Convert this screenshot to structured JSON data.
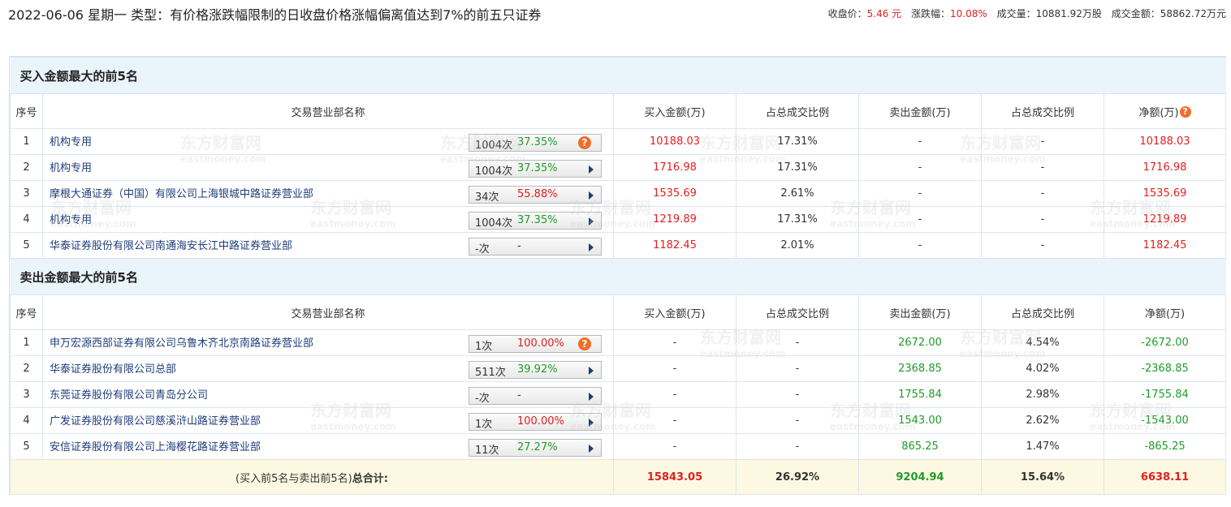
{
  "header": {
    "title": "2022-06-06 星期一 类型：有价格涨跌幅限制的日收盘价格涨幅偏离值达到7%的前五只证券",
    "close_label": "收盘价：",
    "close_value": "5.46 元",
    "change_label": "涨跌幅：",
    "change_value": "10.08%",
    "volume_label": "成交量：",
    "volume_value": "10881.92万股",
    "amount_label": "成交金额：",
    "amount_value": "58862.72万元"
  },
  "columns": {
    "seq": "序号",
    "name": "交易营业部名称",
    "buy": "买入金额(万)",
    "buy_ratio": "占总成交比例",
    "sell": "卖出金额(万)",
    "sell_ratio": "占总成交比例",
    "net": "净额(万)"
  },
  "buy_section": {
    "title": "买入金额最大的前5名",
    "rows": [
      {
        "seq": "1",
        "name": "机构专用",
        "count": "1004次",
        "pct": "37.35%",
        "pct_color": "green",
        "icon": "question-icon",
        "buy": "10188.03",
        "buy_ratio": "17.31%",
        "sell": "-",
        "sell_ratio": "-",
        "net": "10188.03"
      },
      {
        "seq": "2",
        "name": "机构专用",
        "count": "1004次",
        "pct": "37.35%",
        "pct_color": "green",
        "icon": "arrow-right-icon",
        "buy": "1716.98",
        "buy_ratio": "17.31%",
        "sell": "-",
        "sell_ratio": "-",
        "net": "1716.98"
      },
      {
        "seq": "3",
        "name": "摩根大通证券（中国）有限公司上海银城中路证券营业部",
        "count": "34次",
        "pct": "55.88%",
        "pct_color": "red",
        "icon": "arrow-right-icon",
        "buy": "1535.69",
        "buy_ratio": "2.61%",
        "sell": "-",
        "sell_ratio": "-",
        "net": "1535.69"
      },
      {
        "seq": "4",
        "name": "机构专用",
        "count": "1004次",
        "pct": "37.35%",
        "pct_color": "green",
        "icon": "arrow-right-icon",
        "buy": "1219.89",
        "buy_ratio": "17.31%",
        "sell": "-",
        "sell_ratio": "-",
        "net": "1219.89"
      },
      {
        "seq": "5",
        "name": "华泰证券股份有限公司南通海安长江中路证券营业部",
        "count": "-次",
        "pct": "-",
        "pct_color": "plain",
        "icon": "arrow-right-icon",
        "buy": "1182.45",
        "buy_ratio": "2.01%",
        "sell": "-",
        "sell_ratio": "-",
        "net": "1182.45"
      }
    ]
  },
  "sell_section": {
    "title": "卖出金额最大的前5名",
    "rows": [
      {
        "seq": "1",
        "name": "申万宏源西部证券有限公司乌鲁木齐北京南路证券营业部",
        "count": "1次",
        "pct": "100.00%",
        "pct_color": "red",
        "icon": "question-icon",
        "buy": "-",
        "buy_ratio": "-",
        "sell": "2672.00",
        "sell_ratio": "4.54%",
        "net": "-2672.00"
      },
      {
        "seq": "2",
        "name": "华泰证券股份有限公司总部",
        "count": "511次",
        "pct": "39.92%",
        "pct_color": "green",
        "icon": "arrow-right-icon",
        "buy": "-",
        "buy_ratio": "-",
        "sell": "2368.85",
        "sell_ratio": "4.02%",
        "net": "-2368.85"
      },
      {
        "seq": "3",
        "name": "东莞证券股份有限公司青岛分公司",
        "count": "-次",
        "pct": "-",
        "pct_color": "plain",
        "icon": "arrow-right-icon",
        "buy": "-",
        "buy_ratio": "-",
        "sell": "1755.84",
        "sell_ratio": "2.98%",
        "net": "-1755.84"
      },
      {
        "seq": "4",
        "name": "广发证券股份有限公司慈溪浒山路证券营业部",
        "count": "1次",
        "pct": "100.00%",
        "pct_color": "red",
        "icon": "arrow-right-icon",
        "buy": "-",
        "buy_ratio": "-",
        "sell": "1543.00",
        "sell_ratio": "2.62%",
        "net": "-1543.00"
      },
      {
        "seq": "5",
        "name": "安信证券股份有限公司上海樱花路证券营业部",
        "count": "11次",
        "pct": "27.27%",
        "pct_color": "green",
        "icon": "arrow-right-icon",
        "buy": "-",
        "buy_ratio": "-",
        "sell": "865.25",
        "sell_ratio": "1.47%",
        "net": "-865.25"
      }
    ]
  },
  "total": {
    "label_prefix": "(买入前5名与卖出前5名)",
    "label_bold": "总合计:",
    "buy": "15843.05",
    "buy_ratio": "26.92%",
    "sell": "9204.94",
    "sell_ratio": "15.64%",
    "net": "6638.11"
  },
  "colors": {
    "red": "#e02020",
    "green": "#1f9b2a",
    "link": "#1e3c7a",
    "header_bg": "#eaf4fb",
    "total_bg": "#fdf8e1"
  },
  "watermark": {
    "cn": "东方财富网",
    "en": "eastmoney.com"
  }
}
